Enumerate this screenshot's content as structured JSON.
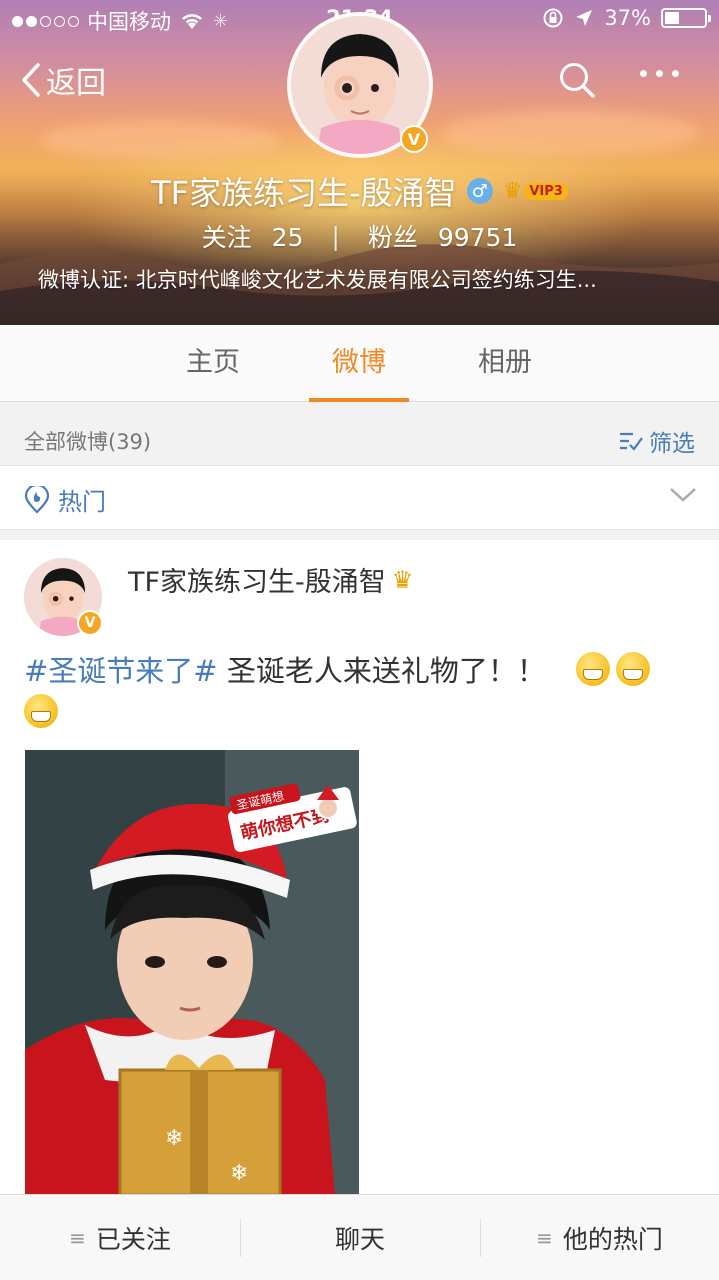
{
  "status_bar": {
    "carrier": "中国移动",
    "time": "21:34",
    "battery_percent": "37%",
    "battery_level": 0.37,
    "signal_bars_filled": 2,
    "signal_bars_total": 5
  },
  "nav": {
    "back_label": "返回",
    "search_icon": "search-icon",
    "more_icon": "more-icon"
  },
  "profile": {
    "name": "TF家族练习生-殷涌智",
    "verified_badge": "V",
    "vip_label": "VIP3",
    "gender_symbol": "♂",
    "following_label": "关注",
    "following_count": "25",
    "divider": "|",
    "followers_label": "粉丝",
    "followers_count": "99751",
    "verification": "微博认证: 北京时代峰峻文化艺术发展有限公司签约练习生..."
  },
  "tabs": [
    {
      "label": "主页",
      "active": false
    },
    {
      "label": "微博",
      "active": true
    },
    {
      "label": "相册",
      "active": false
    }
  ],
  "feed": {
    "count_label": "全部微博(39)",
    "filter_label": "筛选",
    "hot_label": "热门"
  },
  "post": {
    "author": "TF家族练习生-殷涌智",
    "topic": "#圣诞节来了#",
    "text": " 圣诞老人来送礼物了！！",
    "emoji_count": 3,
    "image_sticker_top": "圣诞萌想",
    "image_sticker_main": "萌你想不到"
  },
  "bottom_bar": {
    "follow_label": "已关注",
    "chat_label": "聊天",
    "hot_label": "他的热门"
  },
  "colors": {
    "accent": "#f08a24",
    "link": "#4a7db8",
    "vip": "#f6b512",
    "verified": "#f5a623"
  }
}
